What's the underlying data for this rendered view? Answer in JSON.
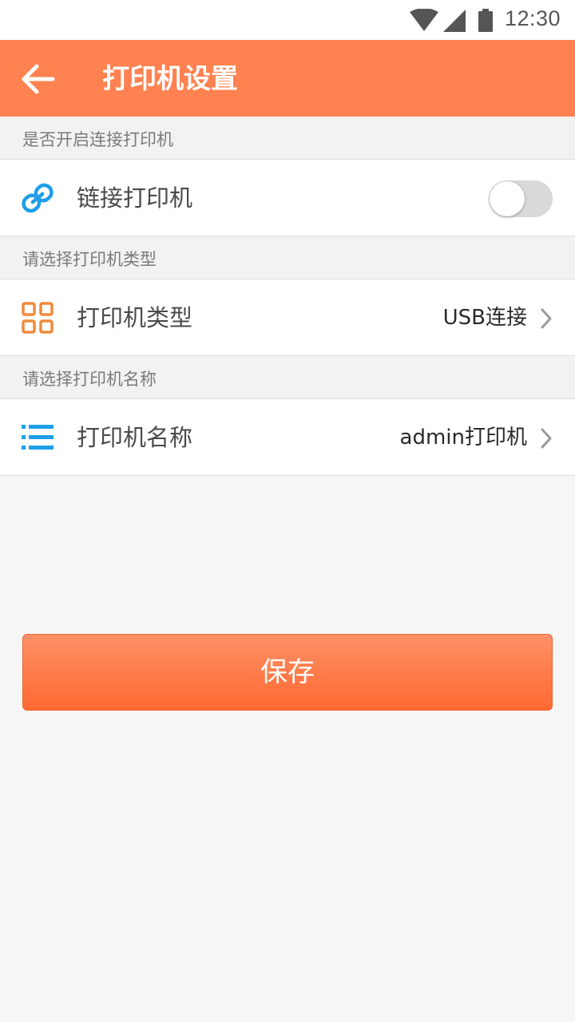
{
  "status_bar": {
    "time": "12:30",
    "icons": [
      "wifi-icon",
      "cellular-signal-icon",
      "battery-icon"
    ]
  },
  "app_bar": {
    "back_icon": "arrow-left-icon",
    "title": "打印机设置"
  },
  "sections": [
    {
      "header": "是否开启连接打印机",
      "row": {
        "icon": "link-icon",
        "label": "链接打印机",
        "toggle_on": false
      }
    },
    {
      "header": "请选择打印机类型",
      "row": {
        "icon": "grid-icon",
        "label": "打印机类型",
        "value": "USB连接"
      }
    },
    {
      "header": "请选择打印机名称",
      "row": {
        "icon": "list-icon",
        "label": "打印机名称",
        "value": "admin打印机"
      }
    }
  ],
  "save_button": {
    "label": "保存"
  },
  "colors": {
    "primary": "#ff8250",
    "background": "#f6f6f6",
    "link_icon": "#1e9ee8",
    "grid_icon": "#f08a3c",
    "list_icon": "#1e9ee8"
  }
}
